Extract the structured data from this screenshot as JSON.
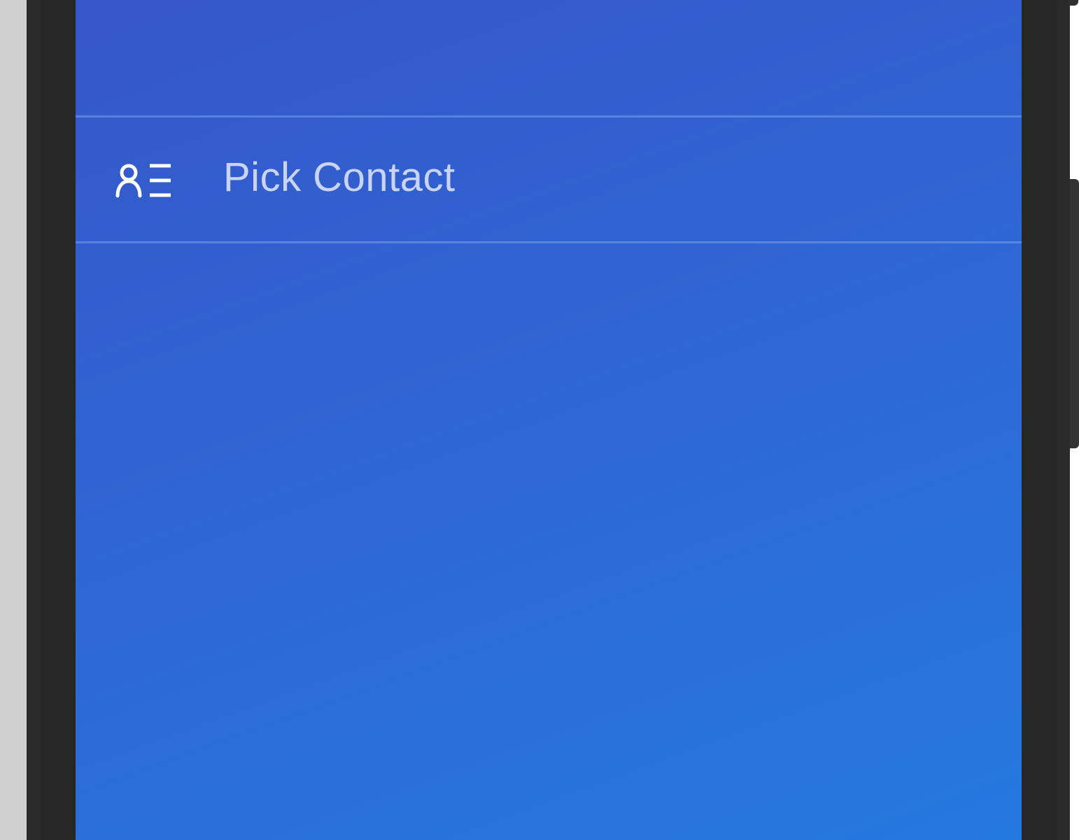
{
  "menu": {
    "items": [
      {
        "label": "Pick Contact",
        "icon": "contact-list-icon"
      }
    ]
  },
  "colors": {
    "screen_gradient_start": "#3656c9",
    "screen_gradient_end": "#2479e0",
    "label_text": "#c9d3f3",
    "device_frame": "#2b2b2b"
  }
}
